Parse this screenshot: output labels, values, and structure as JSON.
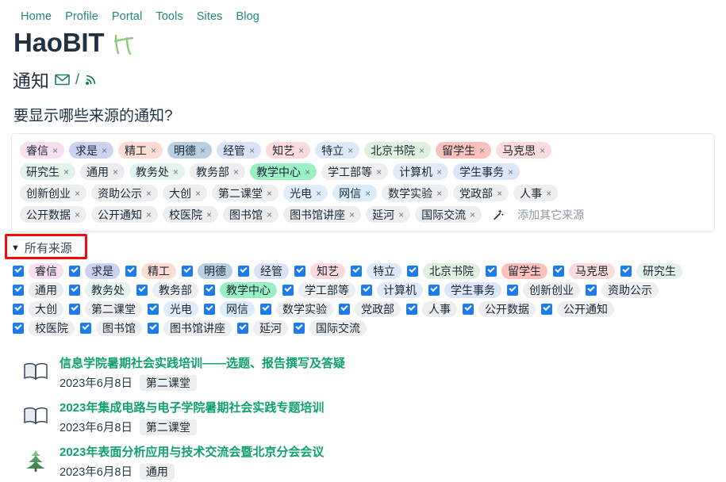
{
  "nav": {
    "items": [
      {
        "label": "Home"
      },
      {
        "label": "Profile"
      },
      {
        "label": "Portal"
      },
      {
        "label": "Tools"
      },
      {
        "label": "Sites"
      },
      {
        "label": "Blog"
      }
    ],
    "link_color": "#1d8a78"
  },
  "site": {
    "title": "HaoBIT",
    "logo_icon": "bit-monogram-icon",
    "logo_color": "#8fc97f"
  },
  "page": {
    "title": "通知",
    "mail_icon": "envelope-icon",
    "separator": "/",
    "rss_icon": "rss-icon",
    "icon_color": "#1b7a68",
    "question": "要显示哪些来源的通知?"
  },
  "selector": {
    "wand_icon": "magic-wand-icon",
    "add_other_label": "添加其它来源",
    "remove_glyph": "×",
    "rows": [
      [
        {
          "label": "睿信",
          "color": "#f7dff0"
        },
        {
          "label": "求是",
          "color": "#ccd2ef"
        },
        {
          "label": "精工",
          "color": "#fcdcd3"
        },
        {
          "label": "明德",
          "color": "#b9cfe2"
        },
        {
          "label": "经管",
          "color": "#d9e3f5"
        },
        {
          "label": "知艺",
          "color": "#fbd9dd"
        },
        {
          "label": "特立",
          "color": "#dde9f6"
        },
        {
          "label": "北京书院",
          "color": "#dff0df"
        },
        {
          "label": "留学生",
          "color": "#fbc2bc"
        },
        {
          "label": "马克思",
          "color": "#fbdcdc"
        }
      ],
      [
        {
          "label": "研究生",
          "color": "#e3f3ec"
        },
        {
          "label": "通用",
          "color": "#ebeced"
        },
        {
          "label": "教务处",
          "color": "#e4f4ee"
        },
        {
          "label": "教务部",
          "color": "#eceef0"
        },
        {
          "label": "教学中心",
          "color": "#9af0c4"
        },
        {
          "label": "学工部等",
          "color": "#eceef0"
        },
        {
          "label": "计算机",
          "color": "#e2eaf8"
        },
        {
          "label": "学生事务",
          "color": "#dbe6f8"
        }
      ],
      [
        {
          "label": "创新创业",
          "color": "#eceef0"
        },
        {
          "label": "资助公示",
          "color": "#eceef0"
        },
        {
          "label": "大创",
          "color": "#eceef0"
        },
        {
          "label": "第二课堂",
          "color": "#eceef0"
        },
        {
          "label": "光电",
          "color": "#e0ecfa"
        },
        {
          "label": "网信",
          "color": "#d9edfb"
        },
        {
          "label": "数学实验",
          "color": "#eceef0"
        },
        {
          "label": "党政部",
          "color": "#eceef0"
        },
        {
          "label": "人事",
          "color": "#eceef0"
        }
      ],
      [
        {
          "label": "公开数据",
          "color": "#eceef0"
        },
        {
          "label": "公开通知",
          "color": "#eceef0"
        },
        {
          "label": "校医院",
          "color": "#eceef0"
        },
        {
          "label": "图书馆",
          "color": "#eceef0"
        },
        {
          "label": "图书馆讲座",
          "color": "#eceef0"
        },
        {
          "label": "延河",
          "color": "#eceef0"
        },
        {
          "label": "国际交流",
          "color": "#eceef0"
        }
      ]
    ]
  },
  "all_sources": {
    "caret": "▼",
    "label": "所有来源",
    "annotation_color": "#f40b0b",
    "rows": [
      [
        {
          "label": "睿信",
          "checked": true,
          "color": "#f7dff0"
        },
        {
          "label": "求是",
          "checked": true,
          "color": "#ccd2ef"
        },
        {
          "label": "精工",
          "checked": true,
          "color": "#fcdcd3"
        },
        {
          "label": "明德",
          "checked": true,
          "color": "#b9cfe2"
        },
        {
          "label": "经管",
          "checked": true,
          "color": "#d9e3f5"
        },
        {
          "label": "知艺",
          "checked": true,
          "color": "#fbd9dd"
        },
        {
          "label": "特立",
          "checked": true,
          "color": "#dde9f6"
        },
        {
          "label": "北京书院",
          "checked": true,
          "color": "#dff0df"
        },
        {
          "label": "留学生",
          "checked": true,
          "color": "#fbc2bc"
        },
        {
          "label": "马克思",
          "checked": true,
          "color": "#fbdcdc"
        },
        {
          "label": "研究生",
          "checked": true,
          "color": "#e3f3ec"
        }
      ],
      [
        {
          "label": "通用",
          "checked": true,
          "color": "#ebeced"
        },
        {
          "label": "教务处",
          "checked": true,
          "color": "#e4f4ee"
        },
        {
          "label": "教务部",
          "checked": true,
          "color": "#eceef0"
        },
        {
          "label": "教学中心",
          "checked": true,
          "color": "#9af0c4"
        },
        {
          "label": "学工部等",
          "checked": true,
          "color": "#eceef0"
        },
        {
          "label": "计算机",
          "checked": true,
          "color": "#e2eaf8"
        },
        {
          "label": "学生事务",
          "checked": true,
          "color": "#dbe6f8"
        },
        {
          "label": "创新创业",
          "checked": true,
          "color": "#eceef0"
        },
        {
          "label": "资助公示",
          "checked": true,
          "color": "#eceef0"
        }
      ],
      [
        {
          "label": "大创",
          "checked": true,
          "color": "#eceef0"
        },
        {
          "label": "第二课堂",
          "checked": true,
          "color": "#eceef0"
        },
        {
          "label": "光电",
          "checked": true,
          "color": "#e0ecfa"
        },
        {
          "label": "网信",
          "checked": true,
          "color": "#d9edfb"
        },
        {
          "label": "数学实验",
          "checked": true,
          "color": "#eceef0"
        },
        {
          "label": "党政部",
          "checked": true,
          "color": "#eceef0"
        },
        {
          "label": "人事",
          "checked": true,
          "color": "#eceef0"
        },
        {
          "label": "公开数据",
          "checked": true,
          "color": "#eceef0"
        },
        {
          "label": "公开通知",
          "checked": true,
          "color": "#eceef0"
        }
      ],
      [
        {
          "label": "校医院",
          "checked": true,
          "color": "#eceef0"
        },
        {
          "label": "图书馆",
          "checked": true,
          "color": "#eceef0"
        },
        {
          "label": "图书馆讲座",
          "checked": true,
          "color": "#eceef0"
        },
        {
          "label": "延河",
          "checked": true,
          "color": "#eceef0"
        },
        {
          "label": "国际交流",
          "checked": true,
          "color": "#eceef0"
        }
      ]
    ]
  },
  "notifications": [
    {
      "icon": "open-book-icon",
      "title": "信息学院暑期社会实践培训——选题、报告撰写及答疑",
      "date": "2023年6月8日",
      "source": "第二课堂"
    },
    {
      "icon": "open-book-icon",
      "title": "2023年集成电路与电子学院暑期社会实践专题培训",
      "date": "2023年6月8日",
      "source": "第二课堂"
    },
    {
      "icon": "evergreen-tree-icon",
      "title": "2023年表面分析应用与技术交流会暨北京分会会议",
      "date": "2023年6月8日",
      "source": "通用"
    }
  ]
}
